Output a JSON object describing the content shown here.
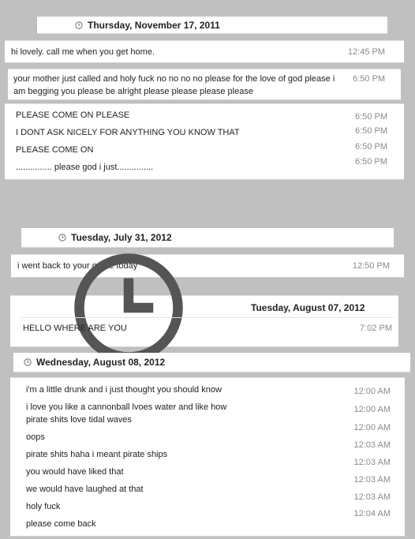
{
  "day1": {
    "date": "Thursday, November 17, 2011",
    "msg1": {
      "text": "hi lovely. call me when you get home.",
      "time": "12:45 PM"
    },
    "msg2": {
      "text": "your mother just called and holy fuck no no no no please for the love of god please i am begging you please be alright please please please please",
      "time": "6:50 PM"
    },
    "msgs": [
      {
        "text": "PLEASE COME ON PLEASE",
        "time": "6:50 PM"
      },
      {
        "text": "I DONT ASK NICELY FOR ANYTHING YOU KNOW THAT",
        "time": "6:50 PM"
      },
      {
        "text": "PLEASE COME ON",
        "time": "6:50 PM"
      },
      {
        "text": "............... please god i just...............",
        "time": "6:50 PM"
      }
    ]
  },
  "day2": {
    "date": "Tuesday, July 31, 2012",
    "msg": {
      "text": "i went back to your grave today",
      "time": "12:50 PM"
    }
  },
  "day3": {
    "date": "Tuesday, August 07, 2012",
    "msg": {
      "text": "HELLO WHERE ARE YOU",
      "time": "7:02 PM"
    }
  },
  "day4": {
    "date": "Wednesday, August 08, 2012",
    "msgs": [
      {
        "text": "i'm a little drunk and i just thought you should know",
        "time": "12:00 AM"
      },
      {
        "text": "i love you like a cannonball lvoes water and like how pirate shits love tidal waves",
        "time": "12:00 AM"
      },
      {
        "text": "",
        "time": "12:00 AM"
      },
      {
        "text": "oops",
        "time": "12:03 AM"
      },
      {
        "text": "pirate shits haha i meant pirate ships",
        "time": "12:03 AM"
      },
      {
        "text": "you would have liked that",
        "time": "12:03 AM"
      },
      {
        "text": "we would have laughed at that",
        "time": "12:03 AM"
      },
      {
        "text": "holy fuck",
        "time": "12:04 AM"
      },
      {
        "text": "please come back",
        "time": ""
      }
    ]
  }
}
